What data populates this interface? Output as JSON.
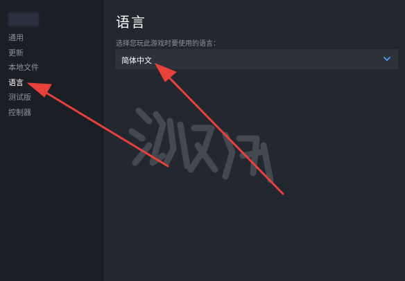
{
  "sidebar": {
    "items": [
      {
        "label": "通用",
        "active": false
      },
      {
        "label": "更新",
        "active": false
      },
      {
        "label": "本地文件",
        "active": false
      },
      {
        "label": "语言",
        "active": true
      },
      {
        "label": "测试版",
        "active": false
      },
      {
        "label": "控制器",
        "active": false
      }
    ]
  },
  "main": {
    "title": "语言",
    "description": "选择您玩此游戏时要使用的语言：",
    "language_select": {
      "value": "简体中文",
      "icon": "chevron-down-icon"
    }
  },
  "colors": {
    "accent": "#4ea1ff",
    "annotation_arrow": "#e8413c"
  }
}
